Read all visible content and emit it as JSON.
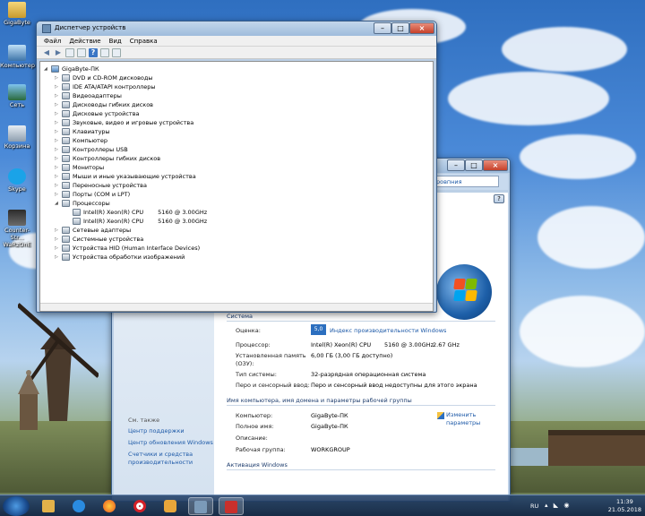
{
  "desktop": {
    "icons": [
      {
        "label": "GigaByte"
      },
      {
        "label": "Компьютер"
      },
      {
        "label": "Сеть"
      },
      {
        "label": "Корзина"
      },
      {
        "label": "Skype"
      },
      {
        "label": "Counter-Str... WaRzOnE"
      }
    ]
  },
  "device_manager": {
    "title": "Диспетчер устройств",
    "menu": [
      "Файл",
      "Действие",
      "Вид",
      "Справка"
    ],
    "tree": {
      "root": "GigaByte-ПК",
      "categories": [
        "DVD и CD-ROM дисководы",
        "IDE ATA/ATAPI контроллеры",
        "Видеоадаптеры",
        "Дисководы гибких дисков",
        "Дисковые устройства",
        "Звуковые, видео и игровые устройства",
        "Клавиатуры",
        "Компьютер",
        "Контроллеры USB",
        "Контроллеры гибких дисков",
        "Мониторы",
        "Мыши и иные указывающие устройства",
        "Переносные устройства",
        "Порты (COM и LPT)",
        "Процессоры"
      ],
      "processors": [
        {
          "name": "Intel(R) Xeon(R) CPU",
          "speed": "5160  @ 3.00GHz"
        },
        {
          "name": "Intel(R) Xeon(R) CPU",
          "speed": "5160  @ 3.00GHz"
        }
      ],
      "categories_after": [
        "Сетевые адаптеры",
        "Системные устройства",
        "Устройства HID (Human Interface Devices)",
        "Устройства обработки изображений"
      ]
    }
  },
  "system_window": {
    "address_crumb": "ровпния",
    "see_also": {
      "title": "См. также",
      "links": [
        "Центр поддержки",
        "Центр обновления Windows",
        "Счетчики и средства производительности"
      ]
    },
    "system_section": {
      "title": "Система",
      "rating_label": "Оценка:",
      "rating_link": "Индекс производительности Windows",
      "processor_label": "Процессор:",
      "processor_value": "Intel(R) Xeon(R) CPU",
      "processor_model": "5160  @ 3.00GHz",
      "processor_freq": "2.67 GHz",
      "ram_label": "Установленная память (ОЗУ):",
      "ram_value": "6,00 ГБ (3,00 ГБ доступно)",
      "type_label": "Тип системы:",
      "type_value": "32-разрядная операционная система",
      "pen_label": "Перо и сенсорный ввод:",
      "pen_value": "Перо и сенсорный ввод недоступны для этого экрана"
    },
    "computer_section": {
      "title": "Имя компьютера, имя домена и параметры рабочей группы",
      "computer_label": "Компьютер:",
      "computer_value": "GigaByte-ПК",
      "full_name_label": "Полное имя:",
      "full_name_value": "GigaByte-ПК",
      "description_label": "Описание:",
      "description_value": "",
      "workgroup_label": "Рабочая группа:",
      "workgroup_value": "WORKGROUP",
      "change_link": "Изменить параметры"
    },
    "activation_title": "Активация Windows"
  },
  "taskbar": {
    "lang": "RU",
    "time": "11:39",
    "date": "21.05.2018"
  }
}
